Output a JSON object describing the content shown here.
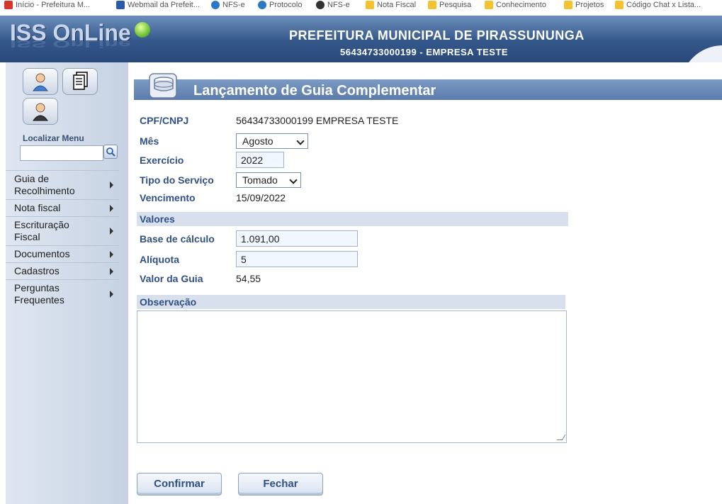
{
  "bookmarks": [
    {
      "label": "Início - Prefeitura M...",
      "color": "#d9362b"
    },
    {
      "label": "Webmail da Prefeit...",
      "color": "#2a5aa8"
    },
    {
      "label": "NFS-e",
      "color": "#2b79c2"
    },
    {
      "label": "Protocolo",
      "color": "#2b79c2"
    },
    {
      "label": "NFS-e",
      "color": "#333333"
    },
    {
      "label": "Nota Fiscal",
      "color": "#f2c230"
    },
    {
      "label": "Pesquisa",
      "color": "#f2c230"
    },
    {
      "label": "Conhecimento",
      "color": "#f2c230"
    },
    {
      "label": "Projetos",
      "color": "#f2c230"
    },
    {
      "label": "Código Chat x Lista...",
      "color": "#f2c230"
    }
  ],
  "header": {
    "logo": "ISS OnLine",
    "city": "PREFEITURA MUNICIPAL DE PIRASSUNUNGA",
    "company": "56434733000199 - EMPRESA TESTE"
  },
  "sidebar": {
    "locate_label": "Localizar Menu",
    "locate_value": "",
    "items": [
      {
        "label": "Guia de Recolhimento"
      },
      {
        "label": "Nota fiscal"
      },
      {
        "label": "Escrituração Fiscal"
      },
      {
        "label": "Documentos"
      },
      {
        "label": "Cadastros"
      },
      {
        "label": "Perguntas Frequentes"
      }
    ]
  },
  "form": {
    "title": "Lançamento de Guia Complementar",
    "cpf_label": "CPF/CNPJ",
    "cpf_value": "56434733000199  EMPRESA TESTE",
    "mes_label": "Mês",
    "mes_value": "Agosto",
    "exercicio_label": "Exercício",
    "exercicio_value": "2022",
    "tipo_label": "Tipo do Serviço",
    "tipo_value": "Tomado",
    "venc_label": "Vencimento",
    "venc_value": "15/09/2022",
    "valores_title": "Valores",
    "base_label": "Base de cálculo",
    "base_value": "1.091,00",
    "aliquota_label": "Alíquota",
    "aliquota_value": "5",
    "valor_label": "Valor da Guia",
    "valor_value": "54,55",
    "obs_title": "Observação",
    "obs_value": "",
    "confirm_label": "Confirmar",
    "close_label": "Fechar"
  }
}
